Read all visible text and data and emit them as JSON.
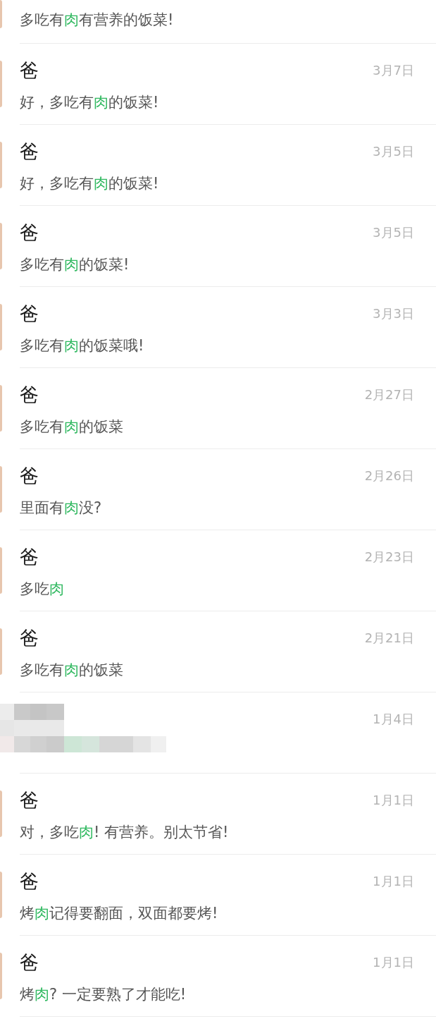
{
  "results": [
    {
      "kind": "partial",
      "message": [
        {
          "text": "多吃有",
          "highlight": false
        },
        {
          "text": "肉",
          "highlight": true
        },
        {
          "text": "有营养的饭菜!",
          "highlight": false
        }
      ]
    },
    {
      "kind": "message",
      "sender": "爸",
      "date": "3月7日",
      "message": [
        {
          "text": "好，多吃有",
          "highlight": false
        },
        {
          "text": "肉",
          "highlight": true
        },
        {
          "text": "的饭菜!",
          "highlight": false
        }
      ]
    },
    {
      "kind": "message",
      "sender": "爸",
      "date": "3月5日",
      "message": [
        {
          "text": "好，多吃有",
          "highlight": false
        },
        {
          "text": "肉",
          "highlight": true
        },
        {
          "text": "的饭菜!",
          "highlight": false
        }
      ]
    },
    {
      "kind": "message",
      "sender": "爸",
      "date": "3月5日",
      "message": [
        {
          "text": "多吃有",
          "highlight": false
        },
        {
          "text": "肉",
          "highlight": true
        },
        {
          "text": "的饭菜!",
          "highlight": false
        }
      ]
    },
    {
      "kind": "message",
      "sender": "爸",
      "date": "3月3日",
      "message": [
        {
          "text": "多吃有",
          "highlight": false
        },
        {
          "text": "肉",
          "highlight": true
        },
        {
          "text": "的饭菜哦!",
          "highlight": false
        }
      ]
    },
    {
      "kind": "message",
      "sender": "爸",
      "date": "2月27日",
      "message": [
        {
          "text": "多吃有",
          "highlight": false
        },
        {
          "text": "肉",
          "highlight": true
        },
        {
          "text": "的饭菜",
          "highlight": false
        }
      ]
    },
    {
      "kind": "message",
      "sender": "爸",
      "date": "2月26日",
      "message": [
        {
          "text": "里面有",
          "highlight": false
        },
        {
          "text": "肉",
          "highlight": true
        },
        {
          "text": "没?",
          "highlight": false
        }
      ]
    },
    {
      "kind": "message",
      "sender": "爸",
      "date": "2月23日",
      "message": [
        {
          "text": "多吃",
          "highlight": false
        },
        {
          "text": "肉",
          "highlight": true
        }
      ]
    },
    {
      "kind": "message",
      "sender": "爸",
      "date": "2月21日",
      "message": [
        {
          "text": "多吃有",
          "highlight": false
        },
        {
          "text": "肉",
          "highlight": true
        },
        {
          "text": "的饭菜",
          "highlight": false
        }
      ]
    },
    {
      "kind": "redacted",
      "date": "1月4日"
    },
    {
      "kind": "message",
      "sender": "爸",
      "date": "1月1日",
      "message": [
        {
          "text": "对，多吃",
          "highlight": false
        },
        {
          "text": "肉",
          "highlight": true
        },
        {
          "text": "! 有营养。别太节省!",
          "highlight": false
        }
      ]
    },
    {
      "kind": "message",
      "sender": "爸",
      "date": "1月1日",
      "message": [
        {
          "text": "烤",
          "highlight": false
        },
        {
          "text": "肉",
          "highlight": true
        },
        {
          "text": "记得要翻面，双面都要烤!",
          "highlight": false
        }
      ]
    },
    {
      "kind": "message",
      "sender": "爸",
      "date": "1月1日",
      "message": [
        {
          "text": "烤",
          "highlight": false
        },
        {
          "text": "肉",
          "highlight": true
        },
        {
          "text": "? 一定要熟了才能吃!",
          "highlight": false
        }
      ]
    }
  ]
}
